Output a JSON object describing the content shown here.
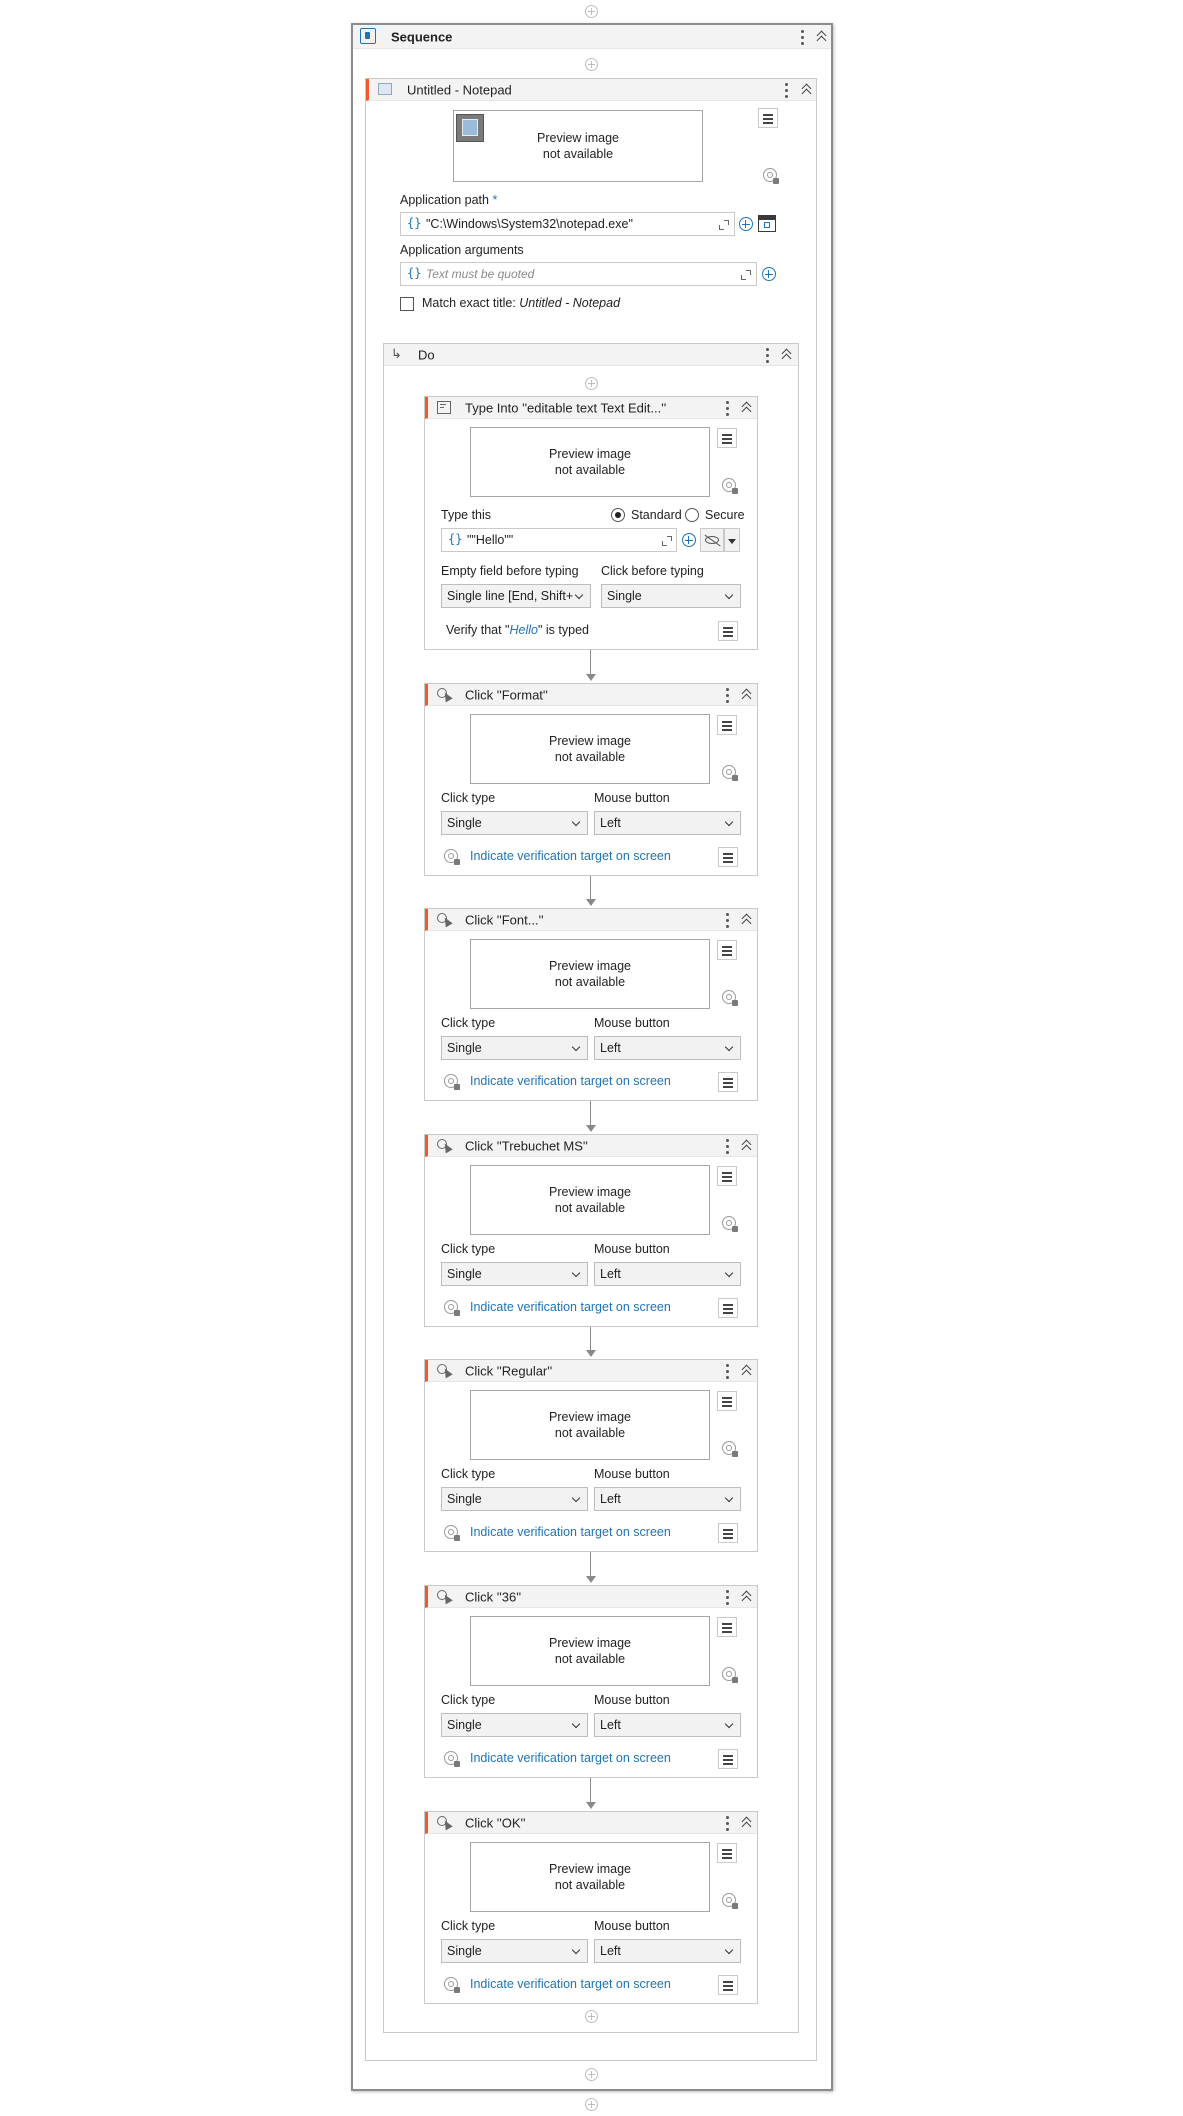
{
  "sequence": {
    "title": "Sequence"
  },
  "open_app": {
    "title": "Untitled - Notepad",
    "preview_line1": "Preview image",
    "preview_line2": "not available",
    "app_path_label": "Application path",
    "required_mark": "*",
    "app_path_value": "\"C:\\Windows\\System32\\notepad.exe\"",
    "app_args_label": "Application arguments",
    "app_args_placeholder": "Text must be quoted",
    "match_label": "Match exact title:",
    "match_title": "Untitled - Notepad"
  },
  "do": {
    "title": "Do"
  },
  "type_into": {
    "title": "Type Into ''editable text Text Edit...''",
    "preview_line1": "Preview image",
    "preview_line2": "not available",
    "type_this_label": "Type this",
    "radio_standard": "Standard",
    "radio_secure": "Secure",
    "value": "\"\"Hello\"\"",
    "empty_field_label": "Empty field before typing",
    "empty_field_value": "Single line [End, Shift+H",
    "click_before_label": "Click before typing",
    "click_before_value": "Single",
    "verify_pre": "Verify that \"",
    "verify_word": "Hello",
    "verify_post": "\" is typed"
  },
  "clicks": [
    {
      "title": "Click ''Format''",
      "click_type_label": "Click type",
      "click_type": "Single",
      "mouse_label": "Mouse button",
      "mouse": "Left",
      "preview_line1": "Preview image",
      "preview_line2": "not available",
      "verify_link": "Indicate verification target on screen"
    },
    {
      "title": "Click ''Font...''",
      "click_type_label": "Click type",
      "click_type": "Single",
      "mouse_label": "Mouse button",
      "mouse": "Left",
      "preview_line1": "Preview image",
      "preview_line2": "not available",
      "verify_link": "Indicate verification target on screen"
    },
    {
      "title": "Click ''Trebuchet MS''",
      "click_type_label": "Click type",
      "click_type": "Single",
      "mouse_label": "Mouse button",
      "mouse": "Left",
      "preview_line1": "Preview image",
      "preview_line2": "not available",
      "verify_link": "Indicate verification target on screen"
    },
    {
      "title": "Click ''Regular''",
      "click_type_label": "Click type",
      "click_type": "Single",
      "mouse_label": "Mouse button",
      "mouse": "Left",
      "preview_line1": "Preview image",
      "preview_line2": "not available",
      "verify_link": "Indicate verification target on screen"
    },
    {
      "title": "Click ''36''",
      "click_type_label": "Click type",
      "click_type": "Single",
      "mouse_label": "Mouse button",
      "mouse": "Left",
      "preview_line1": "Preview image",
      "preview_line2": "not available",
      "verify_link": "Indicate verification target on screen"
    },
    {
      "title": "Click ''OK''",
      "click_type_label": "Click type",
      "click_type": "Single",
      "mouse_label": "Mouse button",
      "mouse": "Left",
      "preview_line1": "Preview image",
      "preview_line2": "not available",
      "verify_link": "Indicate verification target on screen"
    }
  ],
  "colors": {
    "accent": "#f25a29",
    "link": "#1f73b7"
  }
}
